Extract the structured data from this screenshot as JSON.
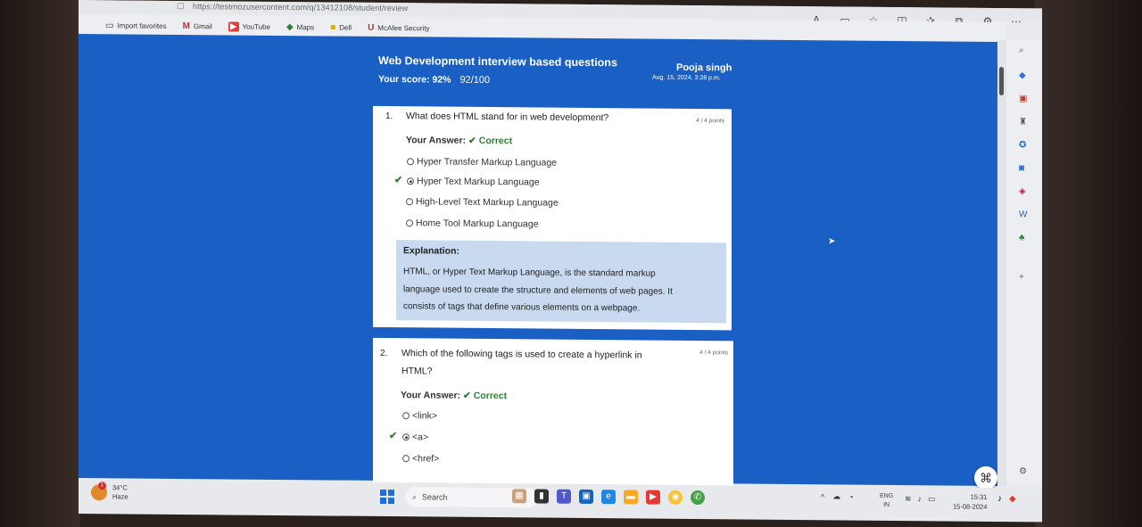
{
  "browser": {
    "url": "https://testmozusercontent.com/q/13412108/student/review",
    "favorites": [
      {
        "label": "Import favorites",
        "icon": "import-icon"
      },
      {
        "label": "Gmail",
        "icon": "gmail-icon"
      },
      {
        "label": "YouTube",
        "icon": "youtube-icon"
      },
      {
        "label": "Maps",
        "icon": "maps-icon"
      },
      {
        "label": "Dell",
        "icon": "folder-icon"
      },
      {
        "label": "McAfee Security",
        "icon": "mcafee-icon"
      }
    ]
  },
  "quiz": {
    "title": "Web Development interview based questions",
    "score_label": "Your score: 92%",
    "score_fraction": "92/100",
    "student_name": "Pooja singh",
    "date": "Aug. 15, 2024, 3:28 p.m."
  },
  "questions": [
    {
      "number": "1.",
      "text": "What does HTML stand for in web development?",
      "points": "4 / 4 points",
      "your_answer_label": "Your Answer:",
      "result": "Correct",
      "options": [
        "Hyper Transfer Markup Language",
        "Hyper Text Markup Language",
        "High-Level Text Markup Language",
        "Home Tool Markup Language"
      ],
      "selected_index": 1,
      "explanation_title": "Explanation:",
      "explanation_lines": [
        "HTML, or Hyper Text Markup Language, is the standard markup",
        "language used to create the structure and elements of web pages. It",
        "consists of tags that define various elements on a webpage."
      ]
    },
    {
      "number": "2.",
      "text_lines": [
        "Which of the following tags is used to create a hyperlink in",
        "HTML?"
      ],
      "points": "4 / 4 points",
      "your_answer_label": "Your Answer:",
      "result": "Correct",
      "options": [
        "<link>",
        "<a>",
        "<href>"
      ],
      "selected_index": 1
    }
  ],
  "taskbar": {
    "weather_temp": "34°C",
    "weather_desc": "Haze",
    "weather_badge": "1",
    "search_label": "Search",
    "lang_line1": "ENG",
    "lang_line2": "IN",
    "time": "15:31",
    "date": "15-08-2024"
  },
  "colors": {
    "page_bg": "#1a5fc4",
    "correct": "#2e7d32",
    "explanation_bg": "#c8d9f0"
  }
}
